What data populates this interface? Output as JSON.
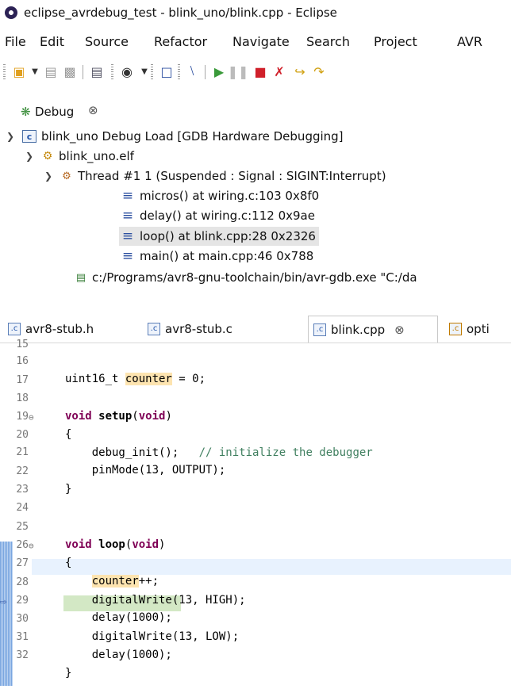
{
  "window": {
    "title": "eclipse_avrdebug_test - blink_uno/blink.cpp - Eclipse"
  },
  "menu": [
    "File",
    "Edit",
    "Source",
    "Refactor",
    "Navigate",
    "Search",
    "Project",
    "AVR"
  ],
  "debug_view": {
    "tab_label": "Debug",
    "tree": [
      {
        "label": "blink_uno Debug Load [GDB Hardware Debugging]"
      },
      {
        "label": "blink_uno.elf"
      },
      {
        "label": "Thread #1 1 (Suspended : Signal : SIGINT:Interrupt)"
      },
      {
        "label": "micros() at wiring.c:103 0x8f0"
      },
      {
        "label": "delay() at wiring.c:112 0x9ae"
      },
      {
        "label": "loop() at blink.cpp:28 0x2326"
      },
      {
        "label": "main() at main.cpp:46 0x788"
      },
      {
        "label": "c:/Programs/avr8-gnu-toolchain/bin/avr-gdb.exe \"C:/da"
      }
    ]
  },
  "editor": {
    "tabs": [
      {
        "label": "avr8-stub.h"
      },
      {
        "label": "avr8-stub.c"
      },
      {
        "label": "blink.cpp"
      },
      {
        "label": "opti"
      }
    ],
    "line_numbers": [
      "15",
      "16",
      "17",
      "18",
      "19",
      "20",
      "21",
      "22",
      "23",
      "24",
      "25",
      "26",
      "27",
      "28",
      "29",
      "30",
      "31",
      "32"
    ],
    "code": {
      "l16_type": "uint16_t ",
      "l16_var": "counter",
      "l16_rest": " = 0;",
      "l18_kw1": "void",
      "l18_fn": " setup",
      "l18_p1": "(",
      "l18_kw2": "void",
      "l18_p2": ")",
      "l19": "{",
      "l20_code": "    debug_init();   ",
      "l20_comment": "// initialize the debugger",
      "l21": "    pinMode(13, OUTPUT);",
      "l22": "}",
      "l24_kw1": "void",
      "l24_fn": " loop",
      "l24_p1": "(",
      "l24_kw2": "void",
      "l24_p2": ")",
      "l25": "{",
      "l26_var": "counter",
      "l26_rest": "++;",
      "l27": "    digitalWrite(13, HIGH);",
      "l28": "    delay(1000);",
      "l29": "    digitalWrite(13, LOW);",
      "l30": "    delay(1000);",
      "l31": "}"
    }
  }
}
